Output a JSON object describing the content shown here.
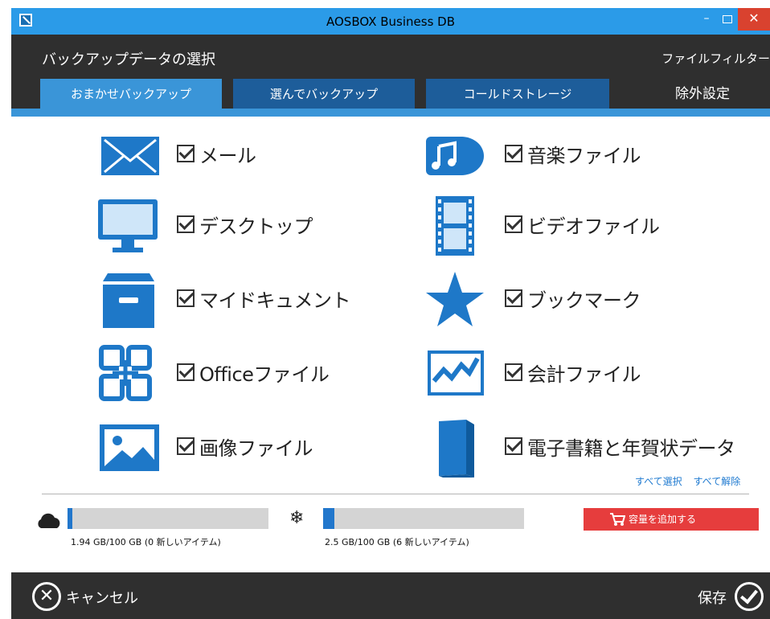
{
  "window": {
    "title": "AOSBOX Business DB",
    "minimize_glyph": "–",
    "close_glyph": "✕"
  },
  "header": {
    "title": "バックアップデータの選択",
    "filter_link": "ファイルフィルター"
  },
  "tabs": [
    {
      "label": "おまかせバックアップ",
      "active": true
    },
    {
      "label": "選んでバックアップ",
      "active": false
    },
    {
      "label": "コールドストレージ",
      "active": false
    },
    {
      "label": "除外設定",
      "active": false
    }
  ],
  "categories": {
    "left": [
      {
        "label": "メール",
        "icon": "mail-icon",
        "checked": true
      },
      {
        "label": "デスクトップ",
        "icon": "monitor-icon",
        "checked": true
      },
      {
        "label": "マイドキュメント",
        "icon": "archive-box-icon",
        "checked": true
      },
      {
        "label": "Officeファイル",
        "icon": "office-icon",
        "checked": true
      },
      {
        "label": "画像ファイル",
        "icon": "image-icon",
        "checked": true
      }
    ],
    "right": [
      {
        "label": "音楽ファイル",
        "icon": "music-icon",
        "checked": true
      },
      {
        "label": "ビデオファイル",
        "icon": "film-icon",
        "checked": true
      },
      {
        "label": "ブックマーク",
        "icon": "star-icon",
        "checked": true
      },
      {
        "label": "会計ファイル",
        "icon": "chart-line-icon",
        "checked": true
      },
      {
        "label": "電子書籍と年賀状データ",
        "icon": "book-icon",
        "checked": true
      }
    ]
  },
  "selection": {
    "select_all": "すべて選択",
    "deselect_all": "すべて解除"
  },
  "storage": {
    "cloud": {
      "text": "1.94 GB/100 GB (0 新しいアイテム)",
      "fraction": 0.0194
    },
    "cold": {
      "text": "2.5 GB/100 GB (6 新しいアイテム)",
      "fraction": 0.025
    },
    "add_capacity_label": "容量を追加する"
  },
  "footer": {
    "cancel_label": "キャンセル",
    "save_label": "保存"
  },
  "colors": {
    "accent": "#3a95d8",
    "icon_blue": "#1e78c8",
    "dark": "#2f2f2f",
    "add_button": "#e63d3d"
  }
}
